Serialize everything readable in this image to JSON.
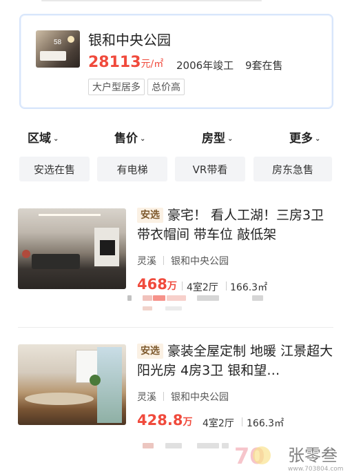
{
  "community": {
    "photo_count": "58",
    "name": "银和中央公园",
    "price": "28113",
    "price_unit": "元/㎡",
    "built_year": "2006年竣工",
    "on_sale": "9套在售",
    "tags": [
      "大户型居多",
      "总价高"
    ]
  },
  "filters": [
    {
      "label": "区域"
    },
    {
      "label": "售价"
    },
    {
      "label": "房型"
    },
    {
      "label": "更多"
    }
  ],
  "quick_chips": [
    "安选在售",
    "有电梯",
    "VR带看",
    "房东急售"
  ],
  "listings": [
    {
      "badge": "安选",
      "title": "豪宅！ 看人工湖！三房3卫 带衣帽间 带车位 敲低架",
      "district": "灵溪",
      "community": "银和中央公园",
      "price": "468",
      "price_unit": "万",
      "layout": "4室2厅",
      "area": "166.3㎡"
    },
    {
      "badge": "安选",
      "title": "豪装全屋定制 地暖 江景超大阳光房 4房3卫 银和望…",
      "district": "灵溪",
      "community": "银和中央公园",
      "price": "428.8",
      "price_unit": "万",
      "layout": "4室2厅",
      "area": "166.3㎡"
    }
  ],
  "watermark": {
    "text": "张零叁",
    "url": "www.703804.com"
  },
  "colors": {
    "accent": "#f04a3c",
    "badge_bg": "#fbf1e4",
    "chip_bg": "#f3f4f6"
  }
}
